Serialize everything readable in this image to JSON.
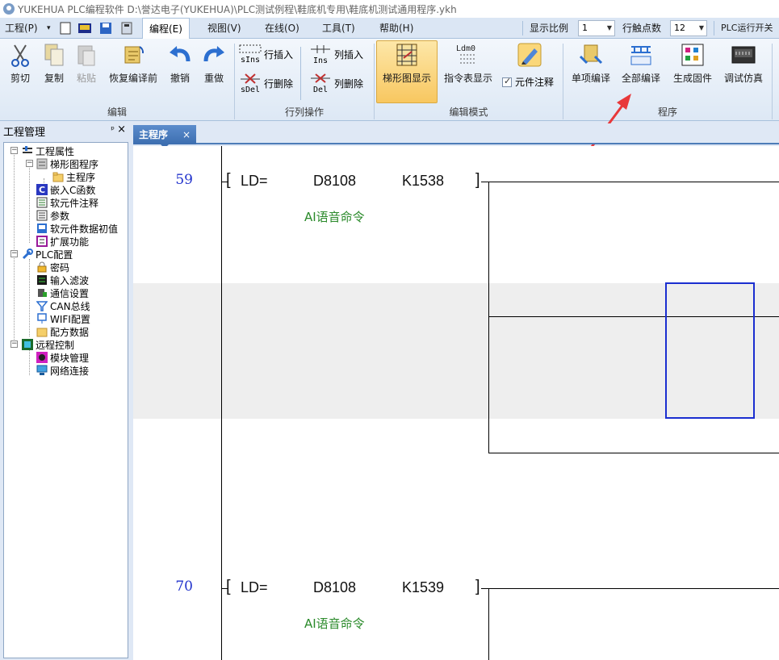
{
  "title": "YUKEHUA PLC编程软件 D:\\誉达电子(YUKEHUA)\\PLC测试例程\\鞋底机专用\\鞋底机测试通用程序.ykh",
  "menu": {
    "project": "工程(P)",
    "edit": "编程(E)",
    "view": "视图(V)",
    "online": "在线(O)",
    "tools": "工具(T)",
    "help": "帮助(H)",
    "display_scale_label": "显示比例",
    "display_scale_value": "1",
    "row_points_label": "行触点数",
    "row_points_value": "12",
    "plc_run_switch": "PLC运行开关"
  },
  "ribbon": {
    "cut": "剪切",
    "copy": "复制",
    "paste": "粘贴",
    "restore": "恢复编译前",
    "undo": "撤销",
    "redo": "重做",
    "row_insert": "行插入",
    "row_delete": "行删除",
    "col_insert": "列插入",
    "col_delete": "列删除",
    "sins": "sIns",
    "sdel": "sDel",
    "ins": "Ins",
    "del": "Del",
    "ladder_display": "梯形图显示",
    "instruction_display": "指令表显示",
    "ldm_label": "Ldm0",
    "component_comment": "元件注释",
    "single_compile": "单项编译",
    "compile_all": "全部编译",
    "generate_firmware": "生成固件",
    "debug_simulate": "调试仿真",
    "group_edit": "编辑",
    "group_row_col": "行列操作",
    "group_edit_mode": "编辑模式",
    "group_program": "程序"
  },
  "left_panel": {
    "title": "工程管理",
    "tree": {
      "project_props": "工程属性",
      "ladder_program": "梯形图程序",
      "main_program": "主程序",
      "embedded_c": "嵌入C函数",
      "soft_comment": "软元件注释",
      "params": "参数",
      "soft_init": "软元件数据初值",
      "extension": "扩展功能",
      "plc_config": "PLC配置",
      "password": "密码",
      "input_filter": "输入滤波",
      "comm_settings": "通信设置",
      "can_bus": "CAN总线",
      "wifi_config": "WIFI配置",
      "recipe_data": "配方数据",
      "remote_control": "远程控制",
      "module_mgmt": "模块管理",
      "network_conn": "网络连接"
    }
  },
  "doc_tab": {
    "label": "主程序",
    "close": "×"
  },
  "ladder": {
    "rungs": [
      {
        "number": "59",
        "op": "LD=",
        "arg1": "D8108",
        "arg2": "K1538",
        "comment": "AI语音命令"
      },
      {
        "number": "70",
        "op": "LD=",
        "arg1": "D8108",
        "arg2": "K1539",
        "comment": "AI语音命令"
      }
    ]
  },
  "colors": {
    "accent": "#3c6eb0",
    "comment_green": "#2a8a2a",
    "row_number_blue": "#2233cc",
    "cursor_blue": "#1a2ed0",
    "annotation_red": "#e8383a"
  }
}
